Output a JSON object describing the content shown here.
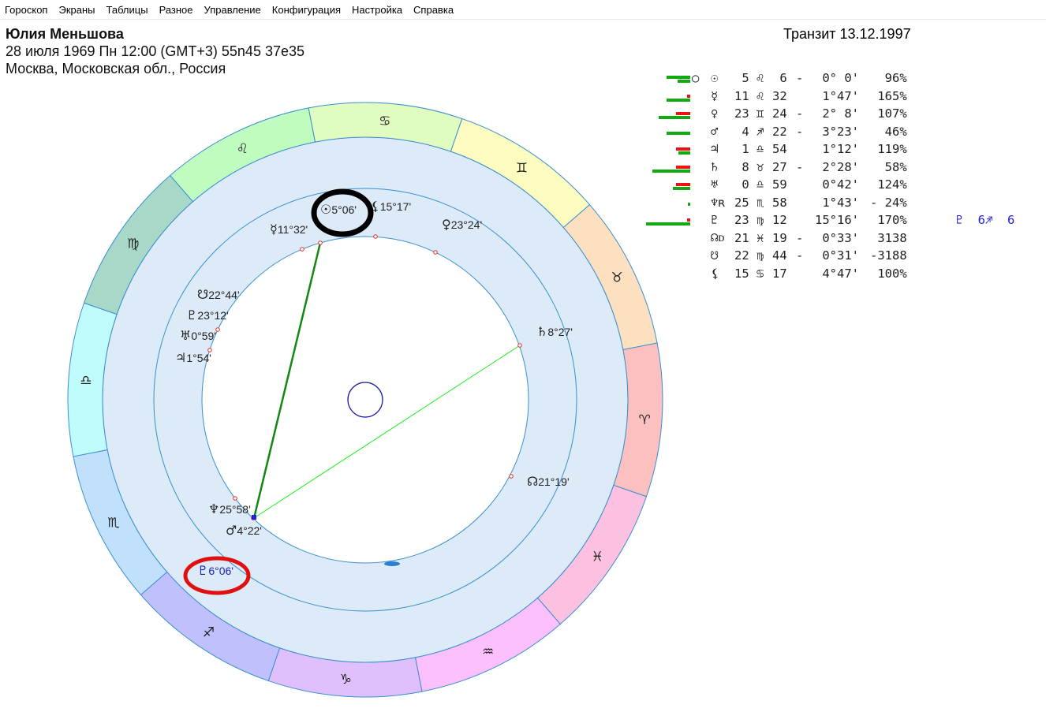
{
  "menu": [
    "Гороскоп",
    "Экраны",
    "Таблицы",
    "Разное",
    "Управление",
    "Конфигурация",
    "Настройка",
    "Справка"
  ],
  "header": {
    "name": "Юлия Меньшова",
    "date_line": "28 июля 1969  Пн  12:00 (GMT+3) 55n45  37e35",
    "place": "Москва, Московская обл., Россия",
    "transit": "Транзит 13.12.1997"
  },
  "signs": [
    "♋",
    "♊",
    "♉",
    "♈",
    "♓",
    "♒",
    "♑",
    "♐",
    "♏",
    "♎",
    "♍",
    "♌"
  ],
  "sign_colors": [
    "#e0fcc0",
    "#fcfcc0",
    "#fce0c0",
    "#fcc0c0",
    "#fcc0e0",
    "#fcc0fc",
    "#e0c0fc",
    "#c0c0fc",
    "#c0e0fc",
    "#c0fcfc",
    "#a8d8c8",
    "#c0fcc0"
  ],
  "wheel_labels": {
    "sun": {
      "g": "☉",
      "t": "5°06'"
    },
    "lilith": {
      "g": "⚸",
      "t": "15°17'"
    },
    "mercury": {
      "g": "☿",
      "t": "11°32'"
    },
    "venus": {
      "g": "♀",
      "t": "23°24'"
    },
    "snode": {
      "g": "☋",
      "t": "22°44'"
    },
    "pluto": {
      "g": "♇",
      "t": "23°12'"
    },
    "uranus": {
      "g": "♅",
      "t": "0°59'"
    },
    "jupiter": {
      "g": "♃",
      "t": "1°54'"
    },
    "saturn": {
      "g": "♄",
      "t": "8°27'"
    },
    "nnode": {
      "g": "☊",
      "t": "21°19'"
    },
    "neptune": {
      "g": "♆",
      "t": "25°58'"
    },
    "mars": {
      "g": "♂",
      "t": "4°22'"
    },
    "tpluto": {
      "g": "♇",
      "t": "6°06'"
    }
  },
  "table": [
    {
      "mark": "○",
      "p": "☉",
      "deg": " 5",
      "s": "♌",
      "min": " 6",
      "sep": "-",
      "orb": " 0° 0'",
      "pct": "  96%",
      "bars": [
        30,
        16,
        0
      ]
    },
    {
      "p": "☿",
      "deg": "11",
      "s": "♌",
      "min": "32",
      "sep": " ",
      "orb": " 1°47'",
      "pct": " 165%",
      "bars": [
        30,
        0,
        4
      ]
    },
    {
      "p": "♀",
      "deg": "23",
      "s": "♊",
      "min": "24",
      "sep": "-",
      "orb": " 2° 8'",
      "pct": " 107%",
      "bars": [
        40,
        0,
        18
      ]
    },
    {
      "p": "♂",
      "deg": " 4",
      "s": "♐",
      "min": "22",
      "sep": "-",
      "orb": " 3°23'",
      "pct": "  46%",
      "bars": [
        30,
        0,
        0
      ]
    },
    {
      "p": "♃",
      "deg": " 1",
      "s": "♎",
      "min": "54",
      "sep": " ",
      "orb": " 1°12'",
      "pct": " 119%",
      "bars": [
        15,
        0,
        18
      ]
    },
    {
      "p": "♄",
      "deg": " 8",
      "s": "♉",
      "min": "27",
      "sep": "-",
      "orb": " 2°28'",
      "pct": "  58%",
      "bars": [
        48,
        0,
        18
      ]
    },
    {
      "p": "♅",
      "deg": " 0",
      "s": "♎",
      "min": "59",
      "sep": " ",
      "orb": " 0°42'",
      "pct": " 124%",
      "bars": [
        22,
        0,
        18
      ]
    },
    {
      "p": "♆ʀ",
      "deg": "25",
      "s": "♏",
      "min": "58",
      "sep": " ",
      "orb": " 1°43'",
      "pct": "- 24%",
      "bars": [
        3,
        0,
        0
      ]
    },
    {
      "p": "♇",
      "deg": "23",
      "s": "♍",
      "min": "12",
      "sep": " ",
      "orb": "15°16'",
      "pct": " 170%",
      "bars": [
        56,
        0,
        4
      ],
      "extra": {
        "g": "♇",
        "v": "6♐  6"
      }
    },
    {
      "p": "☊ᴅ",
      "deg": "21",
      "s": "♓",
      "min": "19",
      "sep": "-",
      "orb": " 0°33'",
      "pct": " 3138"
    },
    {
      "p": "☋",
      "deg": "22",
      "s": "♍",
      "min": "44",
      "sep": "-",
      "orb": " 0°31'",
      "pct": "-3188"
    },
    {
      "p": "⚸",
      "deg": "15",
      "s": "♋",
      "min": "17",
      "sep": " ",
      "orb": " 4°47'",
      "pct": " 100%"
    }
  ]
}
